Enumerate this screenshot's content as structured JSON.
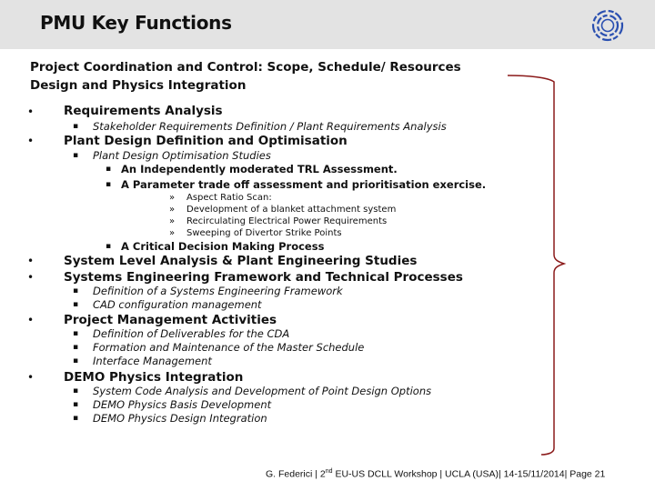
{
  "header": {
    "title": "PMU Key Functions",
    "logo_icon": "fusion-ring-logo-icon"
  },
  "intro": {
    "line1": "Project Coordination and Control: Scope, Schedule/ Resources",
    "line2": "Design and Physics Integration"
  },
  "bullets": {
    "bullet_glyph": "•",
    "sub_glyph": "▪",
    "subsub_glyph": "▪",
    "leaf_glyph": "»",
    "req": {
      "label": "Requirements Analysis",
      "items": [
        "Stakeholder Requirements Definition / Plant Requirements Analysis"
      ]
    },
    "plant": {
      "label": "Plant Design Definition and Optimisation",
      "sub": "Plant Design Optimisation Studies",
      "subsub": [
        "An Independently moderated TRL Assessment.",
        "A Parameter trade off assessment and prioritisation exercise.",
        "A Critical Decision Making Process"
      ],
      "leaves": [
        "Aspect Ratio Scan:",
        "Development of a blanket attachment system",
        "Recirculating Electrical Power Requirements",
        "Sweeping of Divertor Strike Points"
      ]
    },
    "sla": {
      "label": "System Level Analysis & Plant Engineering Studies"
    },
    "sef": {
      "label": "Systems Engineering Framework and Technical Processes",
      "items": [
        "Definition of a Systems Engineering Framework",
        "CAD configuration management"
      ]
    },
    "pma": {
      "label": "Project Management Activities",
      "items": [
        "Definition of Deliverables for the CDA",
        "Formation and Maintenance of the Master Schedule",
        "Interface Management"
      ]
    },
    "demo": {
      "label": "DEMO Physics Integration",
      "items": [
        "System Code Analysis and Development of Point Design Options",
        "DEMO Physics Basis Development",
        "DEMO Physics Design Integration"
      ]
    }
  },
  "brace": {
    "color": "#8b1a1a"
  },
  "footer": {
    "author": "G. Federici | 2",
    "sup": "nd",
    "rest": " EU-US DCLL Workshop | UCLA  (USA)| 14-15/11/2014| Page 21"
  }
}
